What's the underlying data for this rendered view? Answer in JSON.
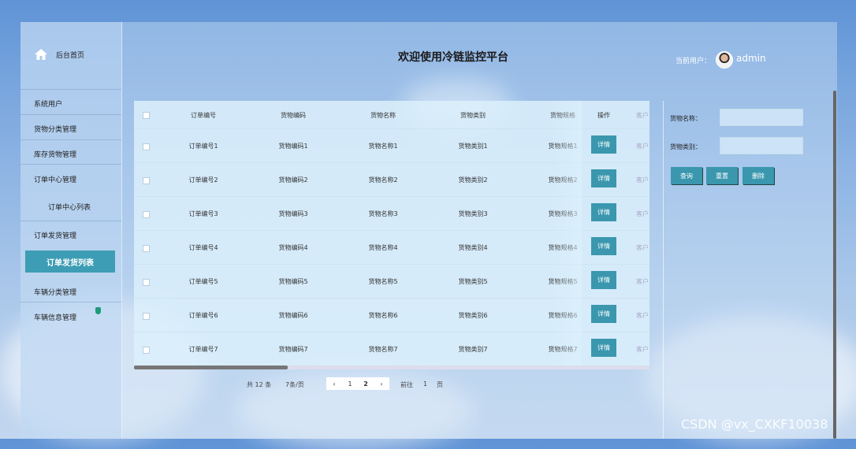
{
  "header": {
    "title": "欢迎使用冷链监控平台",
    "user_label": "当前用户：",
    "username": "admin"
  },
  "sidebar": {
    "home": "后台首页",
    "items": [
      "系统用户",
      "货物分类管理",
      "库存货物管理",
      "订单中心管理",
      "订单中心列表",
      "订单发货管理",
      "订单发货列表",
      "车辆分类管理",
      "车辆信息管理"
    ]
  },
  "table": {
    "headers": [
      "订单编号",
      "货物编码",
      "货物名称",
      "货物类别",
      "货物规格",
      "操作",
      "客户"
    ],
    "rows": [
      {
        "order": "订单编号1",
        "code": "货物编码1",
        "name": "货物名称1",
        "cat": "货物类别1",
        "spec": "货物规格1",
        "cust": "客户"
      },
      {
        "order": "订单编号2",
        "code": "货物编码2",
        "name": "货物名称2",
        "cat": "货物类别2",
        "spec": "货物规格2",
        "cust": "客户"
      },
      {
        "order": "订单编号3",
        "code": "货物编码3",
        "name": "货物名称3",
        "cat": "货物类别3",
        "spec": "货物规格3",
        "cust": "客户"
      },
      {
        "order": "订单编号4",
        "code": "货物编码4",
        "name": "货物名称4",
        "cat": "货物类别4",
        "spec": "货物规格4",
        "cust": "客户"
      },
      {
        "order": "订单编号5",
        "code": "货物编码5",
        "name": "货物名称5",
        "cat": "货物类别5",
        "spec": "货物规格5",
        "cust": "客户"
      },
      {
        "order": "订单编号6",
        "code": "货物编码6",
        "name": "货物名称6",
        "cat": "货物类别6",
        "spec": "货物规格6",
        "cust": "客户"
      },
      {
        "order": "订单编号7",
        "code": "货物编码7",
        "name": "货物名称7",
        "cat": "货物类别7",
        "spec": "货物规格7",
        "cust": "客户"
      }
    ],
    "detail_label": "详情"
  },
  "pagination": {
    "total": "共 12 条",
    "per_page": "7条/页",
    "prev": "‹",
    "pages": [
      "1",
      "2"
    ],
    "next": "›",
    "goto_label": "前往",
    "goto_value": "1",
    "page_suffix": "页"
  },
  "search": {
    "name_label": "货物名称：",
    "cat_label": "货物类别：",
    "query": "查询",
    "reset": "重置",
    "delete": "删除"
  },
  "watermark": "CSDN @vx_CXKF10038",
  "colors": {
    "accent": "#3a97ae"
  }
}
